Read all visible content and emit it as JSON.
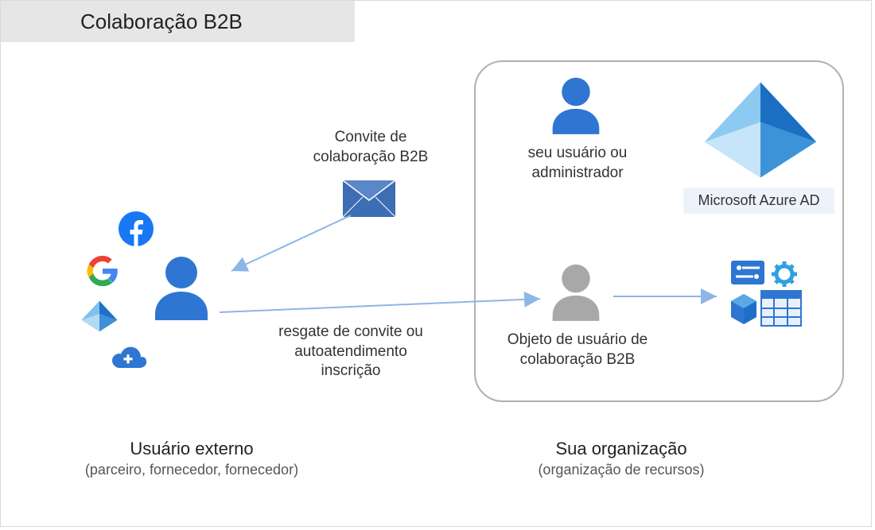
{
  "title": "Colaboração B2B",
  "invite": {
    "line1": "Convite de",
    "line2": "colaboração B2B"
  },
  "redeem": {
    "line1": "resgate de convite ou",
    "line2": "autoatendimento",
    "line3": "inscrição"
  },
  "your_user": {
    "line1": "seu usuário ou",
    "line2": "administrador"
  },
  "b2b_object": {
    "line1": "Objeto de usuário de",
    "line2": "colaboração B2B"
  },
  "azure_ad": "Microsoft Azure AD",
  "external_user": {
    "title": "Usuário externo",
    "subtitle": "(parceiro, fornecedor, fornecedor)"
  },
  "your_org": {
    "title": "Sua organização",
    "subtitle": "(organização de recursos)"
  },
  "icons": {
    "facebook": "facebook-icon",
    "google": "google-icon",
    "azure_small": "azure-ad-icon",
    "cloud_plus": "cloud-plus-icon",
    "external_user": "person-blue-icon",
    "envelope": "envelope-icon",
    "your_user": "person-blue-icon",
    "guest_user": "person-grey-icon",
    "azure_large": "azure-ad-pyramid-icon",
    "resources": "azure-resources-icon"
  },
  "colors": {
    "blue": "#2f76d2",
    "light_blue": "#8db6e6",
    "grey": "#a0a0a0"
  }
}
